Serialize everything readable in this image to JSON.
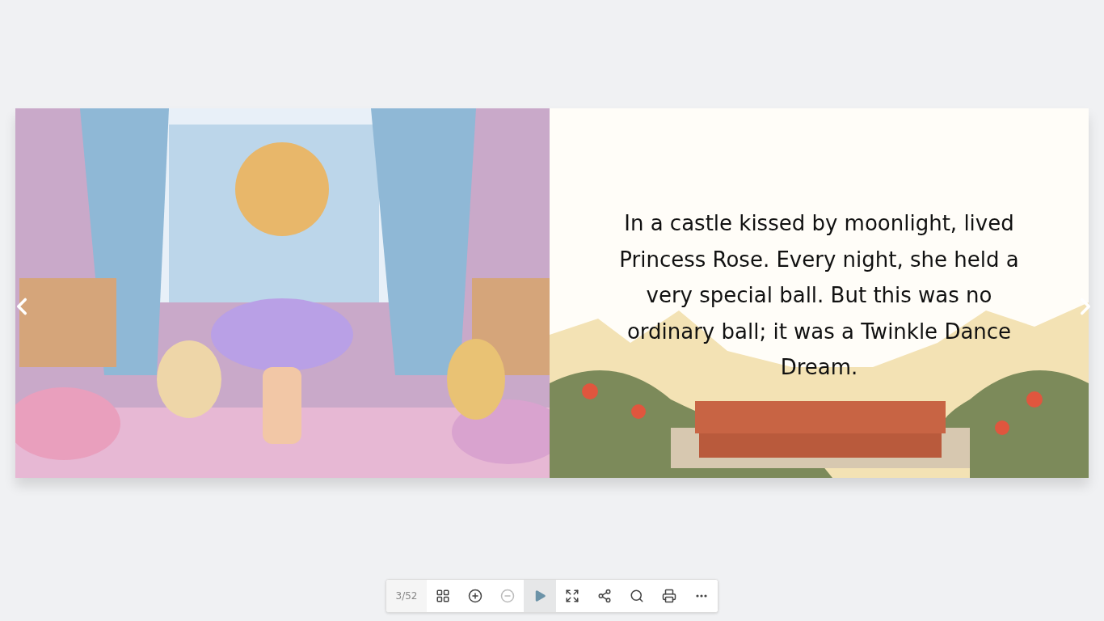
{
  "book": {
    "right_page": {
      "text": "In a castle kissed by moonlight, lived Princess Rose. Every night, she held a very special ball. But this was no ordinary ball; it was a Twinkle Dance Dream."
    }
  },
  "toolbar": {
    "page_counter": "3/52",
    "buttons": [
      {
        "kind": "thumbnails",
        "disabled": false,
        "active": false
      },
      {
        "kind": "zoom-in",
        "disabled": false,
        "active": false
      },
      {
        "kind": "zoom-out",
        "disabled": true,
        "active": false
      },
      {
        "kind": "autoplay",
        "disabled": false,
        "active": true
      },
      {
        "kind": "fullscreen",
        "disabled": false,
        "active": false
      },
      {
        "kind": "share",
        "disabled": false,
        "active": false
      },
      {
        "kind": "search",
        "disabled": false,
        "active": false
      },
      {
        "kind": "print",
        "disabled": false,
        "active": false
      },
      {
        "kind": "more",
        "disabled": false,
        "active": false
      }
    ]
  }
}
